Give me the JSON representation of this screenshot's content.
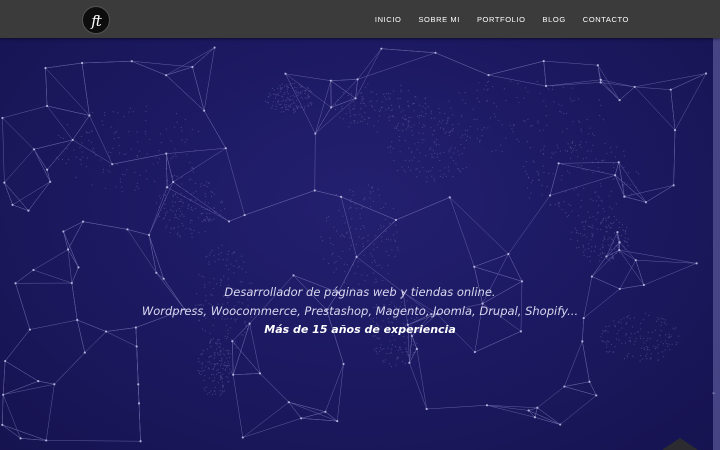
{
  "header": {
    "logo_text": "ft",
    "nav": [
      "INICIO",
      "SOBRE MI",
      "PORTFOLIO",
      "BLOG",
      "CONTACTO"
    ]
  },
  "hero": {
    "line1": "Desarrollador de páginas web y tiendas online.",
    "line2": "Wordpress, Woocommerce, Prestashop, Magento, Joomla, Drupal, Shopify...",
    "line3": "Más de 15 años de experiencia"
  },
  "colors": {
    "header_bg": "#3b3b3b",
    "hero_bg": "#1c1961",
    "network_line": "#8f8dc9",
    "text": "#ffffff"
  }
}
